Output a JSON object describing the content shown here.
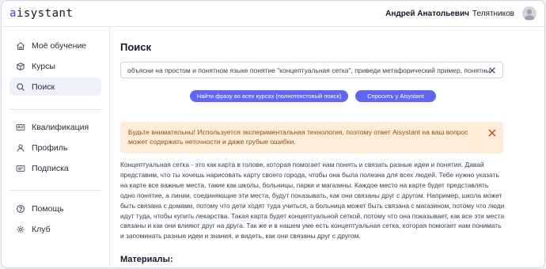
{
  "header": {
    "logo_a": "a",
    "logo_rest": "isystant",
    "user_first": "Андрей Анатольевич",
    "user_last": "Телятников"
  },
  "sidebar": {
    "items": [
      {
        "label": "Моё обучение",
        "icon": "home-icon"
      },
      {
        "label": "Курсы",
        "icon": "box-icon"
      },
      {
        "label": "Поиск",
        "icon": "search-icon",
        "active": true
      },
      {
        "label": "Квалификация",
        "icon": "id-card-icon"
      },
      {
        "label": "Профиль",
        "icon": "user-icon"
      },
      {
        "label": "Подписка",
        "icon": "card-icon"
      },
      {
        "label": "Помощь",
        "icon": "help-icon"
      },
      {
        "label": "Клуб",
        "icon": "club-icon"
      }
    ]
  },
  "main": {
    "title": "Поиск",
    "search_value": "объясни на простом и понятном языке понятие \"концептуальная сетка\", приведи метафорический пример, понятный школьнику",
    "fulltext_button": "Найти фразу во всех курсах (полнотекстовый поиск)",
    "ask_button": "Спросить у Aisystant",
    "warning": "Будьте внимательны! Используется экспериментальная технология, поэтому ответ Aisystant на ваш вопрос может содержать неточности и даже грубые ошибки.",
    "answer": "Концептуальная сетка - это как карта в голове, которая помогает нам понять и связать разные идеи и понятия. Давай представим, что ты хочешь нарисовать карту своего города, чтобы она была полезна для всех людей. Тебе нужно указать на карте все важные места, такие как школы, больницы, парки и магазины. Каждое место на карте будет представлять одно понятие, а линии, соединяющие эти места, будут показывать, как они связаны друг с другом. Например, школа может быть связана с домами, потому что дети ходят туда учиться, а больница может быть связана с магазином, потому что люди идут туда, чтобы купить лекарства. Такая карта будет концептуальной сеткой, потому что она показывает, как все эти места связаны и как они влияют друг на друга. Так же и в нашем уме есть концептуальная сетка, которая помогает нам понимать и запоминать разные идеи и знания, и видеть, как они связаны друг с другом.",
    "materials_title": "Материалы:"
  },
  "colors": {
    "accent": "#6366f1",
    "active_nav_bg": "#eef0fb",
    "warning_bg": "#fdecd8",
    "warning_text": "#9a4b14"
  }
}
